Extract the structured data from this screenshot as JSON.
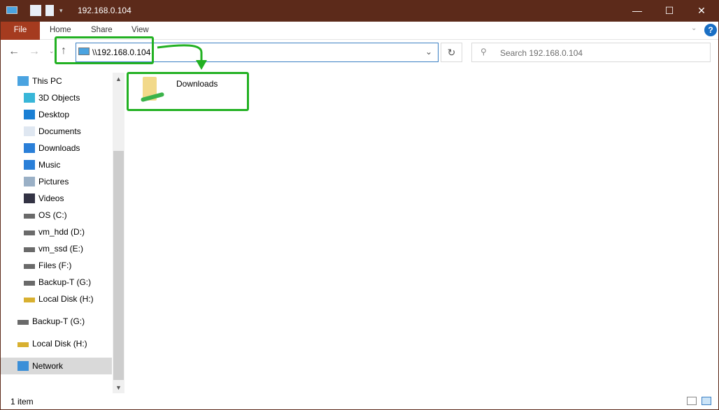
{
  "window": {
    "title": "192.168.0.104",
    "minimize": "—",
    "maximize": "☐",
    "close": "✕"
  },
  "ribbon": {
    "tabs": [
      "File",
      "Home",
      "Share",
      "View"
    ],
    "help": "?"
  },
  "address": {
    "path": "\\\\192.168.0.104",
    "search_placeholder": "Search 192.168.0.104"
  },
  "nav": {
    "items": [
      {
        "label": "This PC",
        "icon": "computer-icon"
      },
      {
        "label": "3D Objects",
        "icon": "cube-icon"
      },
      {
        "label": "Desktop",
        "icon": "desktop-icon"
      },
      {
        "label": "Documents",
        "icon": "document-icon"
      },
      {
        "label": "Downloads",
        "icon": "download-arrow-icon"
      },
      {
        "label": "Music",
        "icon": "music-note-icon"
      },
      {
        "label": "Pictures",
        "icon": "picture-icon"
      },
      {
        "label": "Videos",
        "icon": "film-icon"
      },
      {
        "label": "OS (C:)",
        "icon": "system-drive-icon"
      },
      {
        "label": "vm_hdd (D:)",
        "icon": "drive-icon"
      },
      {
        "label": "vm_ssd (E:)",
        "icon": "drive-icon"
      },
      {
        "label": "Files (F:)",
        "icon": "drive-icon"
      },
      {
        "label": "Backup-T (G:)",
        "icon": "drive-icon"
      },
      {
        "label": "Local Disk (H:)",
        "icon": "locked-drive-icon"
      },
      {
        "label": "Backup-T (G:)",
        "icon": "drive-icon"
      },
      {
        "label": "Local Disk (H:)",
        "icon": "locked-drive-icon"
      },
      {
        "label": "Network",
        "icon": "network-icon"
      }
    ]
  },
  "content": {
    "items": [
      {
        "label": "Downloads",
        "icon": "shared-folder-icon"
      }
    ]
  },
  "status": {
    "count": "1 item"
  },
  "colors": {
    "titlebar": "#5c2a1a",
    "file_tab": "#a53b1f",
    "highlight": "#22b122"
  }
}
